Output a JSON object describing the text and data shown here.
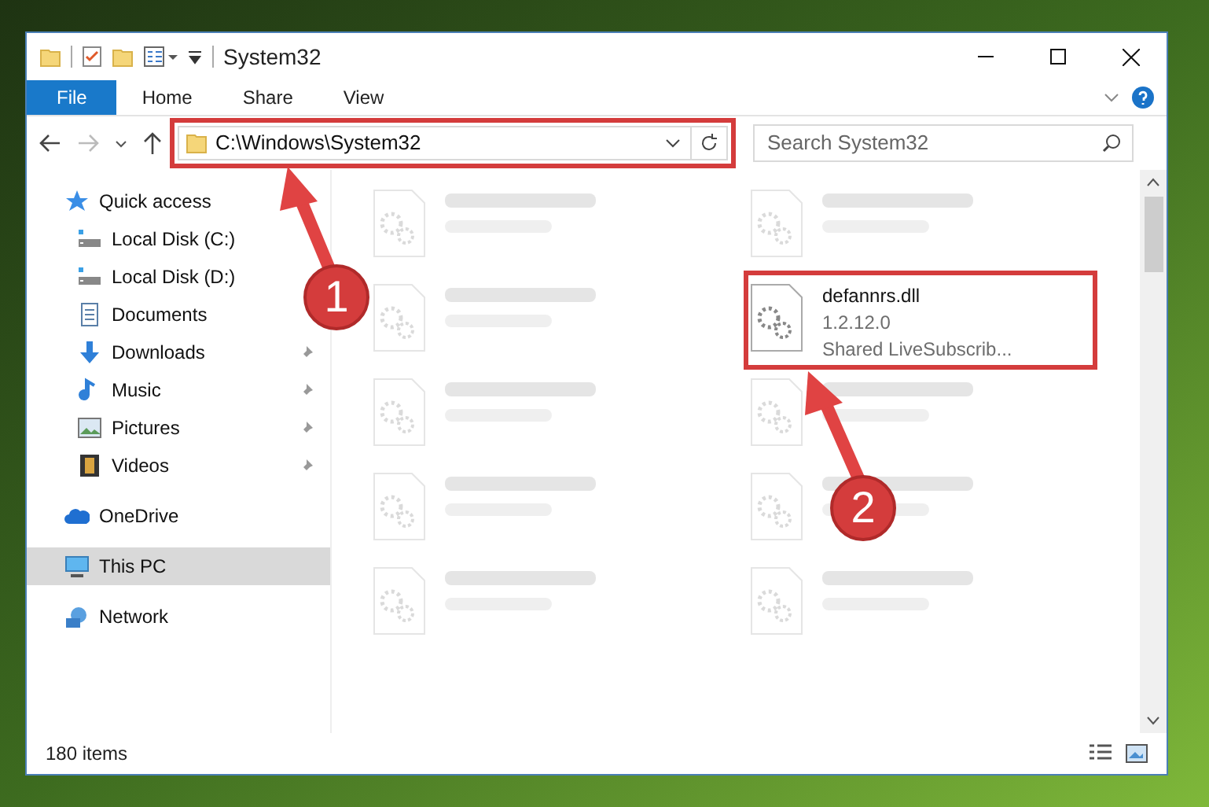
{
  "window": {
    "title": "System32"
  },
  "ribbon_tabs": [
    {
      "label": "File",
      "selected": true
    },
    {
      "label": "Home",
      "selected": false
    },
    {
      "label": "Share",
      "selected": false
    },
    {
      "label": "View",
      "selected": false
    }
  ],
  "address_bar": {
    "path": "C:\\Windows\\System32",
    "highlighted": true
  },
  "search": {
    "placeholder": "Search System32"
  },
  "sidebar": {
    "items": [
      {
        "label": "Quick access",
        "kind": "star",
        "pinned": false,
        "selected": false,
        "group": true
      },
      {
        "label": "Local Disk (C:)",
        "kind": "disk",
        "pinned": false,
        "selected": false,
        "group": false
      },
      {
        "label": "Local Disk (D:)",
        "kind": "disk",
        "pinned": false,
        "selected": false,
        "group": false
      },
      {
        "label": "Documents",
        "kind": "doc",
        "pinned": false,
        "selected": false,
        "group": false
      },
      {
        "label": "Downloads",
        "kind": "download",
        "pinned": true,
        "selected": false,
        "group": false
      },
      {
        "label": "Music",
        "kind": "music",
        "pinned": true,
        "selected": false,
        "group": false
      },
      {
        "label": "Pictures",
        "kind": "picture",
        "pinned": true,
        "selected": false,
        "group": false
      },
      {
        "label": "Videos",
        "kind": "video",
        "pinned": true,
        "selected": false,
        "group": false
      },
      {
        "label": "OneDrive",
        "kind": "cloud",
        "pinned": false,
        "selected": false,
        "group": true
      },
      {
        "label": "This PC",
        "kind": "pc",
        "pinned": false,
        "selected": true,
        "group": true
      },
      {
        "label": "Network",
        "kind": "network",
        "pinned": false,
        "selected": false,
        "group": true
      }
    ]
  },
  "files": [
    {
      "blurred": true
    },
    {
      "blurred": true
    },
    {
      "blurred": true
    },
    {
      "blurred": false,
      "highlighted": true,
      "name": "defannrs.dll",
      "lines": [
        "1.2.12.0",
        "Shared LiveSubscrib..."
      ]
    },
    {
      "blurred": true
    },
    {
      "blurred": true
    },
    {
      "blurred": true
    },
    {
      "blurred": true
    },
    {
      "blurred": true
    },
    {
      "blurred": true
    }
  ],
  "status_bar": {
    "count": "180 items"
  },
  "callouts": [
    {
      "number": "1"
    },
    {
      "number": "2"
    }
  ]
}
